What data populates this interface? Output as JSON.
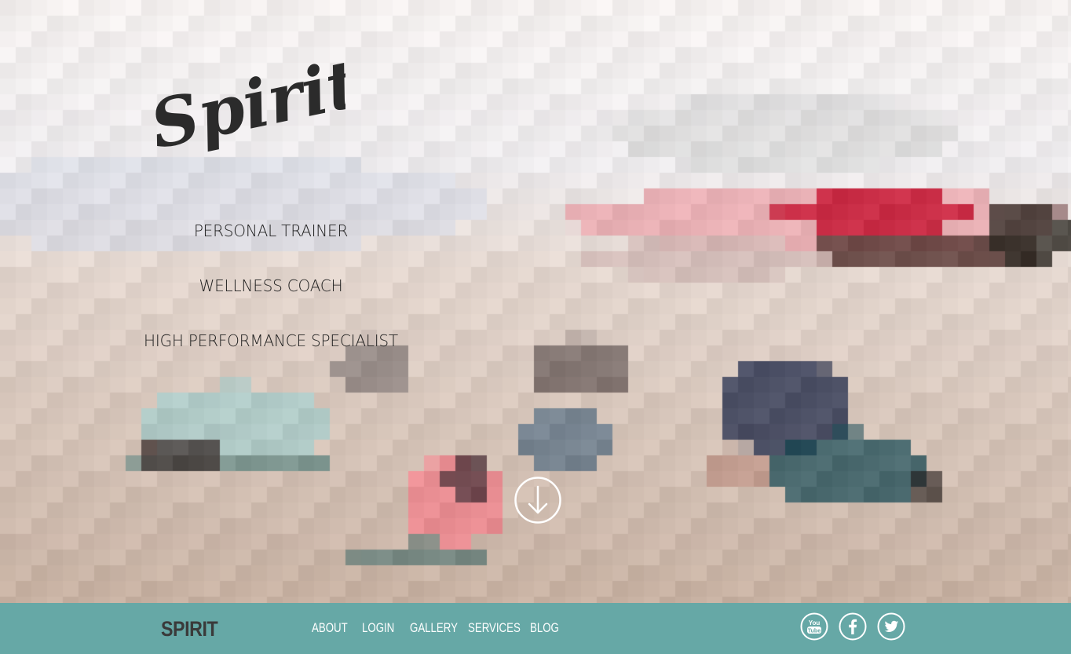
{
  "hero": {
    "logo_text": "Spirit",
    "taglines": [
      "PERSONAL TRAINER",
      "WELLNESS COACH",
      "HIGH PERFORMANCE SPECIALIST"
    ],
    "scroll_icon": "arrow-down-circle-icon"
  },
  "footer": {
    "brand": "SPIRIT",
    "nav": [
      "ABOUT",
      "LOGIN",
      "GALLERY",
      "SERVICES",
      "BLOG"
    ],
    "social": [
      {
        "name": "youtube-icon",
        "label": "You Tube"
      },
      {
        "name": "facebook-icon",
        "label": "f"
      },
      {
        "name": "twitter-icon",
        "label": ""
      }
    ]
  },
  "colors": {
    "footer_bg": "#66a8a6",
    "brand_text": "#3a3a3a",
    "nav_text": "#ffffff",
    "tagline_text": "#1e1e1e"
  }
}
